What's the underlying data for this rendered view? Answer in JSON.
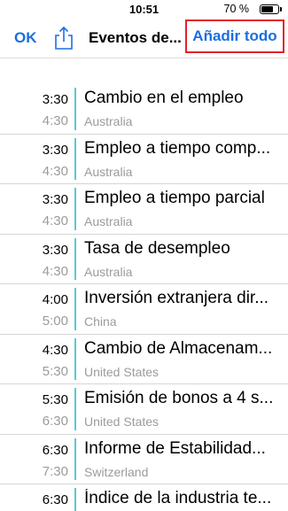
{
  "status_bar": {
    "time": "10:51",
    "battery_text": "70 %",
    "battery_level": 0.7
  },
  "nav": {
    "ok_label": "OK",
    "share_icon": "share-icon",
    "title": "Eventos de...",
    "add_all_label": "Añadir todo"
  },
  "colors": {
    "accent": "#1a6fe0",
    "highlight_box": "#e0242a",
    "event_bar": "#5ac8d6"
  },
  "events": [
    {
      "start": "3:30",
      "end": "4:30",
      "title": "Cambio en el empleo",
      "country": "Australia"
    },
    {
      "start": "3:30",
      "end": "4:30",
      "title": "Empleo a tiempo comp...",
      "country": "Australia"
    },
    {
      "start": "3:30",
      "end": "4:30",
      "title": "Empleo a tiempo parcial",
      "country": "Australia"
    },
    {
      "start": "3:30",
      "end": "4:30",
      "title": "Tasa de desempleo",
      "country": "Australia"
    },
    {
      "start": "4:00",
      "end": "5:00",
      "title": "Inversión extranjera dir...",
      "country": "China"
    },
    {
      "start": "4:30",
      "end": "5:30",
      "title": "Cambio de Almacenam...",
      "country": "United States"
    },
    {
      "start": "5:30",
      "end": "6:30",
      "title": "Emisión de bonos a 4 s...",
      "country": "United States"
    },
    {
      "start": "6:30",
      "end": "7:30",
      "title": "Informe de Estabilidad...",
      "country": "Switzerland"
    },
    {
      "start": "6:30",
      "end": "",
      "title": "Índice de la industria te...",
      "country": ""
    }
  ]
}
